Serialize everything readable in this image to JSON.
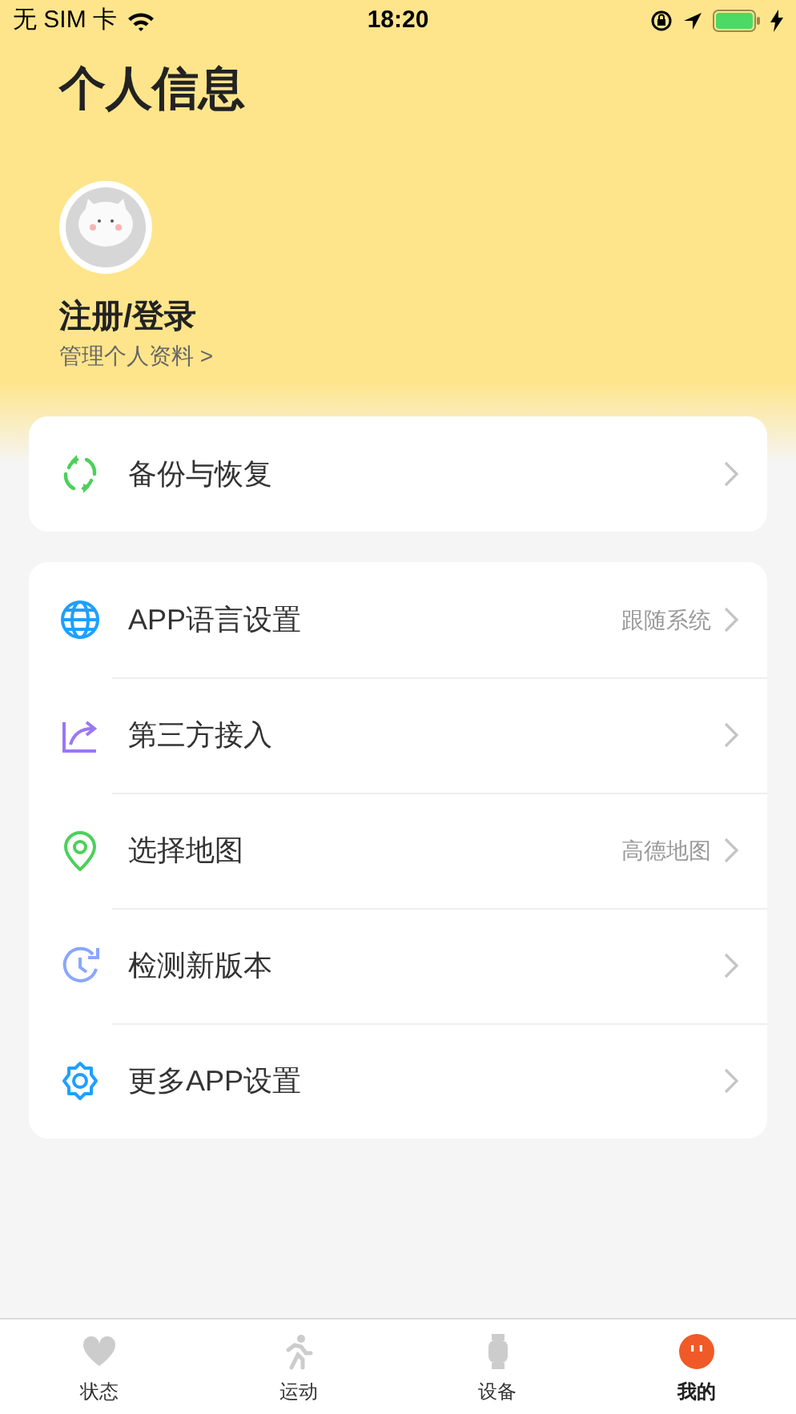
{
  "status_bar": {
    "carrier": "无 SIM 卡",
    "time": "18:20"
  },
  "title": "个人信息",
  "profile": {
    "name": "注册/登录",
    "link": "管理个人资料 >"
  },
  "groups": [
    {
      "items": [
        {
          "label": "备份与恢复"
        }
      ]
    },
    {
      "items": [
        {
          "label": "APP语言设置",
          "value": "跟随系统"
        },
        {
          "label": "第三方接入"
        },
        {
          "label": "选择地图",
          "value": "高德地图"
        },
        {
          "label": "检测新版本"
        },
        {
          "label": "更多APP设置"
        }
      ]
    }
  ],
  "tab_bar": [
    {
      "label": "状态",
      "selected": false
    },
    {
      "label": "运动",
      "selected": false
    },
    {
      "label": "设备",
      "selected": false
    },
    {
      "label": "我的",
      "selected": true
    }
  ]
}
